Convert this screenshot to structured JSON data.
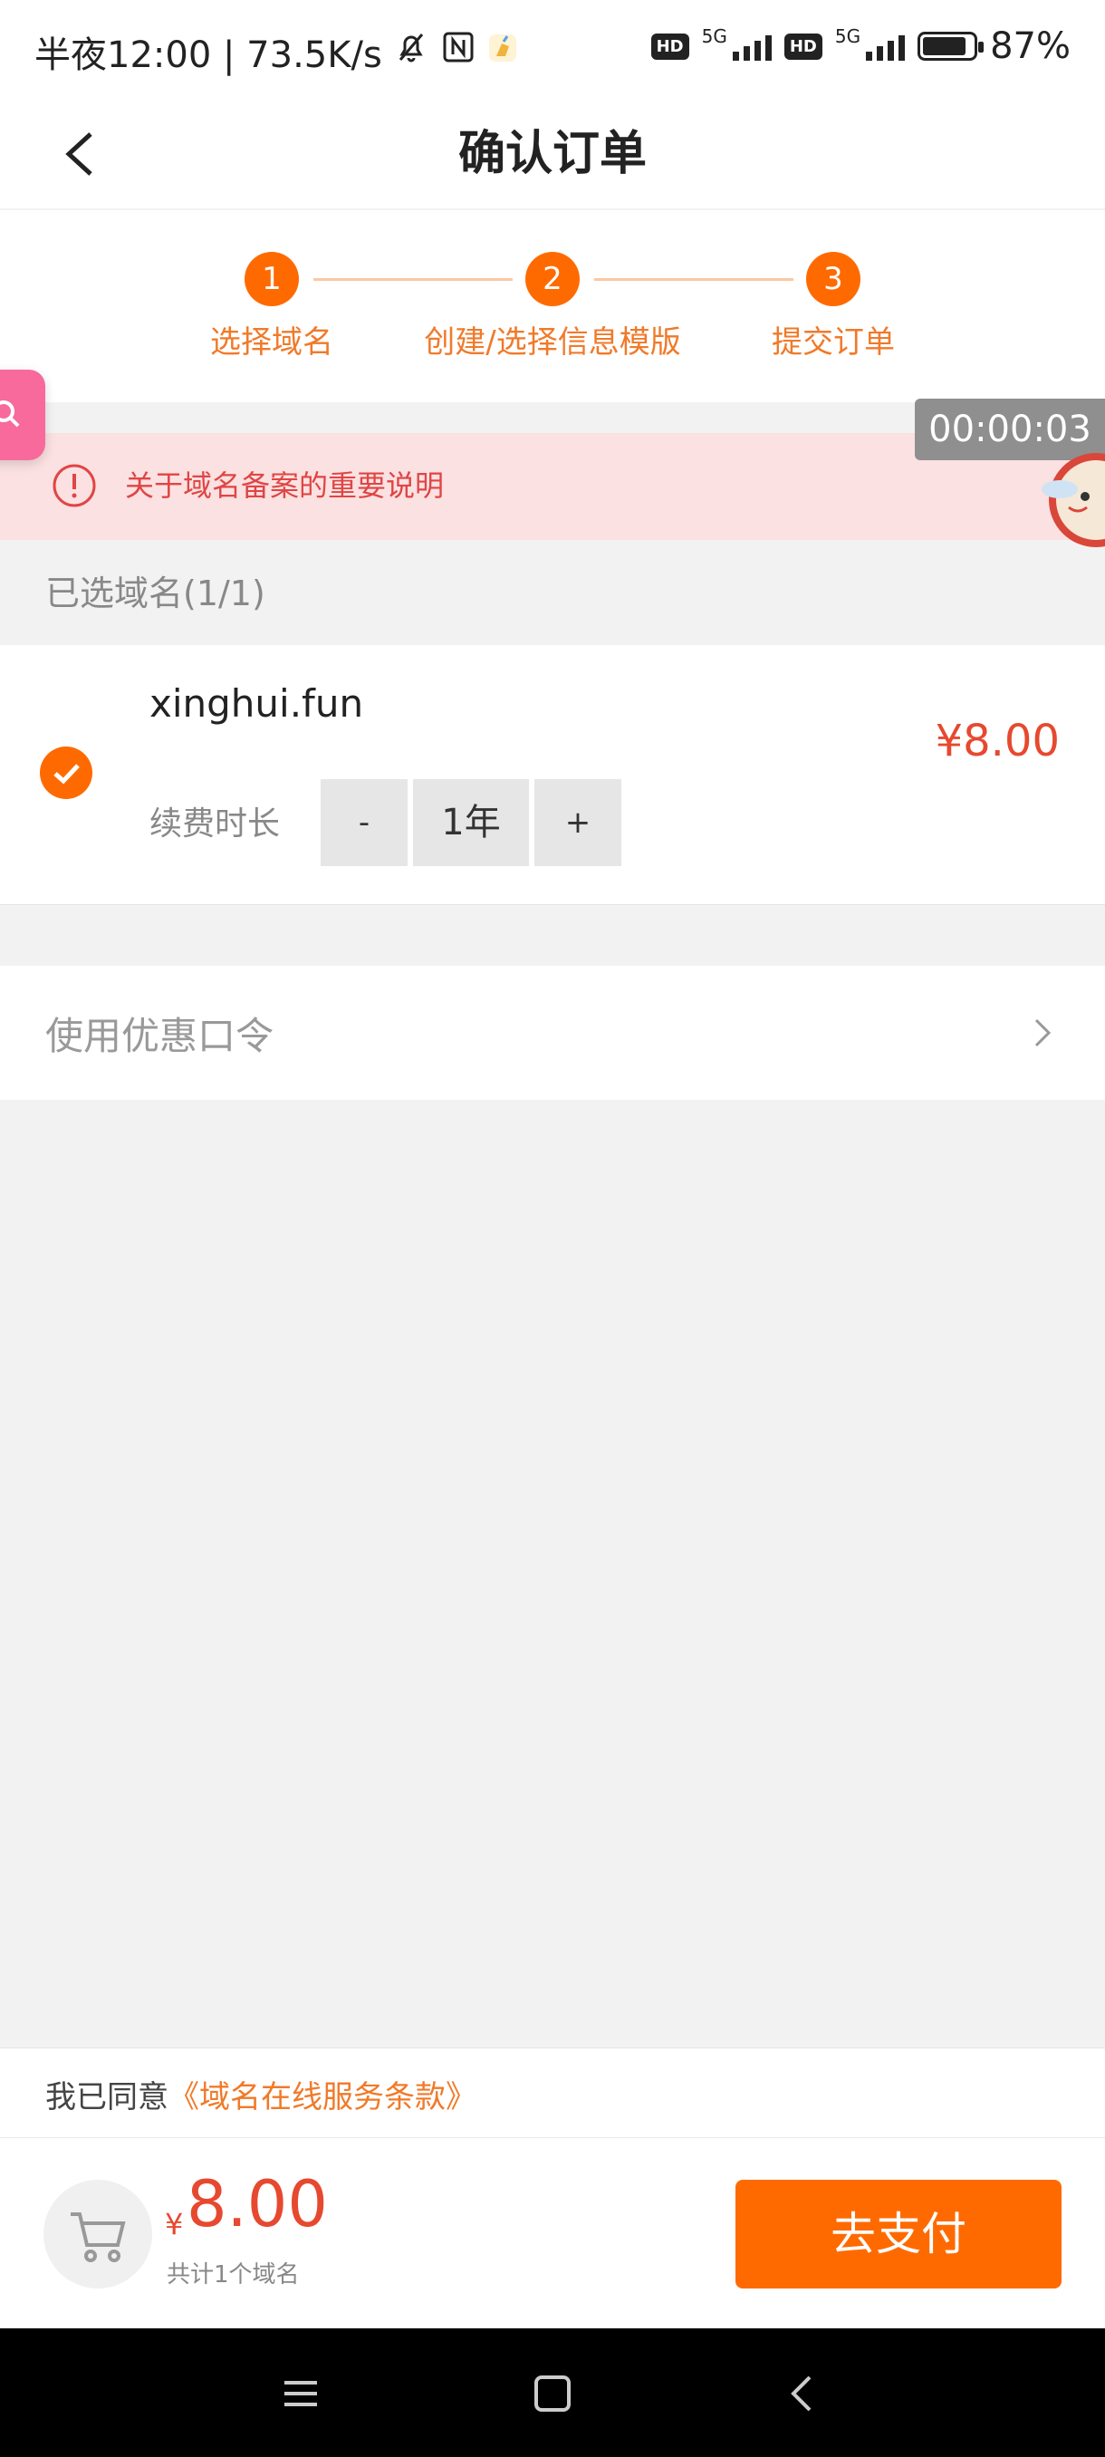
{
  "status_bar": {
    "left_text": "半夜12:00 | 73.5K/s",
    "hd_1": "HD",
    "net_1": "5G",
    "hd_2": "HD",
    "net_2": "5G",
    "battery_text": "87%",
    "battery_level": 0.87
  },
  "header": {
    "title": "确认订单"
  },
  "steps": [
    {
      "num": "1",
      "label": "选择域名"
    },
    {
      "num": "2",
      "label": "创建/选择信息模版"
    },
    {
      "num": "3",
      "label": "提交订单"
    }
  ],
  "timer": "00:00:03",
  "notice": {
    "text": "关于域名备案的重要说明"
  },
  "selected": {
    "label": "已选域名(1/1)"
  },
  "domain": {
    "name": "xinghui.fun",
    "renew_label": "续费时长",
    "minus": "-",
    "value": "1年",
    "plus": "+",
    "price": "¥8.00"
  },
  "coupon": {
    "label": "使用优惠口令"
  },
  "agree": {
    "prefix": "我已同意",
    "link": "《域名在线服务条款》"
  },
  "pay": {
    "yen": "¥",
    "amount": "8.00",
    "count": "共计1个域名",
    "button": "去支付"
  },
  "colors": {
    "accent": "#ff6a00",
    "price": "#e6492f",
    "notice_bg": "#fbe1e1"
  }
}
